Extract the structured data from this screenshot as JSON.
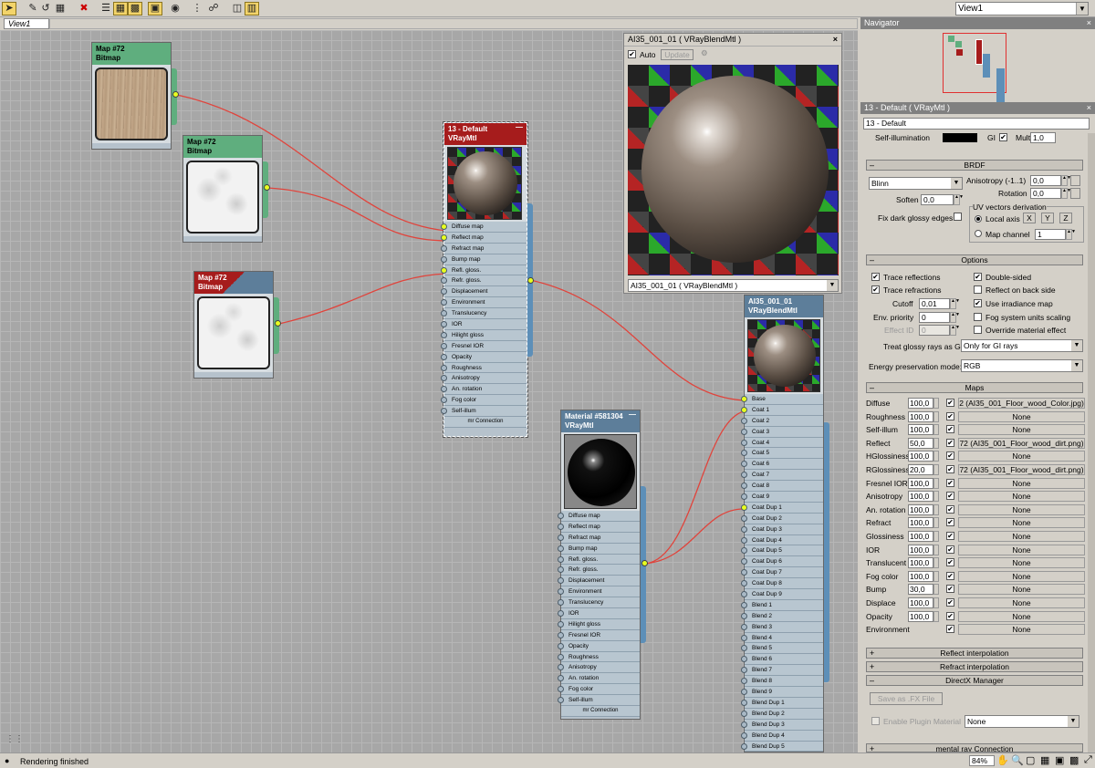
{
  "toolbar": {
    "icons": [
      "select-icon",
      "pick-icon",
      "put-material-icon",
      "assign-icon",
      "delete-icon",
      "layout-icon",
      "grid-icon",
      "pattern-icon",
      "show-map-icon",
      "hide-icon",
      "background-icon",
      "navigator-icon",
      "toggle-icon",
      "options-icon"
    ]
  },
  "view_selector": "View1",
  "tab": "View1",
  "nodes": {
    "map1": {
      "title": "Map #72",
      "subtitle": "Bitmap"
    },
    "map2": {
      "title": "Map #72",
      "subtitle": "Bitmap"
    },
    "map3": {
      "title": "Map #72",
      "subtitle": "Bitmap"
    },
    "default": {
      "title": "13 - Default",
      "subtitle": "VRayMtl",
      "slots": [
        "Diffuse map",
        "Reflect map",
        "Refract map",
        "Bump map",
        "Refl. gloss.",
        "Refr. gloss.",
        "Displacement",
        "Environment",
        "Translucency",
        "IOR",
        "Hilight gloss",
        "Fresnel IOR",
        "Opacity",
        "Roughness",
        "Anisotropy",
        "An. rotation",
        "Fog color",
        "Self-illum"
      ],
      "footer": "mr Connection"
    },
    "blend": {
      "title": "AI35_001_01",
      "subtitle": "VRayBlendMtl",
      "slots": [
        "Base",
        "Coat 1",
        "Coat 2",
        "Coat 3",
        "Coat 4",
        "Coat 5",
        "Coat 6",
        "Coat 7",
        "Coat 8",
        "Coat 9",
        "Coat Dup 1",
        "Coat Dup 2",
        "Coat Dup 3",
        "Coat Dup 4",
        "Coat Dup 5",
        "Coat Dup 6",
        "Coat Dup 7",
        "Coat Dup 8",
        "Coat Dup 9",
        "Blend 1",
        "Blend 2",
        "Blend 3",
        "Blend 4",
        "Blend 5",
        "Blend 6",
        "Blend 7",
        "Blend 8",
        "Blend 9",
        "Blend Dup 1",
        "Blend Dup 2",
        "Blend Dup 3",
        "Blend Dup 4",
        "Blend Dup 5"
      ]
    },
    "mat2": {
      "title": "Material #581304",
      "subtitle": "VRayMtl",
      "slots": [
        "Diffuse map",
        "Reflect map",
        "Refract map",
        "Bump map",
        "Refl. gloss.",
        "Refr. gloss.",
        "Displacement",
        "Environment",
        "Translucency",
        "IOR",
        "Hilight gloss",
        "Fresnel IOR",
        "Opacity",
        "Roughness",
        "Anisotropy",
        "An. rotation",
        "Fog color",
        "Self-illum"
      ],
      "footer": "mr Connection"
    }
  },
  "preview": {
    "title": "AI35_001_01  ( VRayBlendMtl )",
    "close": "×",
    "auto_label": "Auto",
    "update_label": "Update",
    "footer": "AI35_001_01  ( VRayBlendMtl )"
  },
  "navigator": {
    "title": "Navigator",
    "close": "×"
  },
  "material_panel": {
    "title": "13 - Default  ( VRayMtl )",
    "close": "×",
    "name": "13 - Default",
    "self_illum_label": "Self-illumination",
    "gi_label": "GI",
    "mult_label": "Mult",
    "mult_value": "1,0",
    "brdf": {
      "header": "BRDF",
      "type": "Blinn",
      "anisotropy_label": "Anisotropy (-1..1)",
      "anisotropy_value": "0,0",
      "rotation_label": "Rotation",
      "rotation_value": "0,0",
      "soften_label": "Soften",
      "soften_value": "0,0",
      "fix_label": "Fix dark glossy edges",
      "uv_label": "UV vectors derivation",
      "local_axis": "Local axis",
      "x": "X",
      "y": "Y",
      "z": "Z",
      "map_channel": "Map channel",
      "map_channel_value": "1"
    },
    "options": {
      "header": "Options",
      "trace_reflections": "Trace reflections",
      "trace_refractions": "Trace refractions",
      "cutoff_label": "Cutoff",
      "cutoff_value": "0,01",
      "env_priority_label": "Env. priority",
      "env_priority_value": "0",
      "effect_id_label": "Effect ID",
      "effect_id_value": "0",
      "double_sided": "Double-sided",
      "reflect_back": "Reflect on back side",
      "use_irradiance": "Use irradiance map",
      "fog_units": "Fog system units scaling",
      "override_effect": "Override material effect",
      "treat_glossy_label": "Treat glossy rays as GI",
      "treat_glossy_value": "Only for GI rays",
      "energy_label": "Energy preservation mode:",
      "energy_value": "RGB"
    },
    "maps": {
      "header": "Maps",
      "rows": [
        {
          "name": "Diffuse",
          "value": "100,0",
          "map": "2 (AI35_001_Floor_wood_Color.jpg)"
        },
        {
          "name": "Roughness",
          "value": "100,0",
          "map": "None"
        },
        {
          "name": "Self-illum",
          "value": "100,0",
          "map": "None"
        },
        {
          "name": "Reflect",
          "value": "50,0",
          "map": "72 (AI35_001_Floor_wood_dirt.png)"
        },
        {
          "name": "HGlossiness",
          "value": "100,0",
          "map": "None"
        },
        {
          "name": "RGlossiness",
          "value": "20,0",
          "map": "72 (AI35_001_Floor_wood_dirt.png)"
        },
        {
          "name": "Fresnel IOR",
          "value": "100,0",
          "map": "None"
        },
        {
          "name": "Anisotropy",
          "value": "100,0",
          "map": "None"
        },
        {
          "name": "An. rotation",
          "value": "100,0",
          "map": "None"
        },
        {
          "name": "Refract",
          "value": "100,0",
          "map": "None"
        },
        {
          "name": "Glossiness",
          "value": "100,0",
          "map": "None"
        },
        {
          "name": "IOR",
          "value": "100,0",
          "map": "None"
        },
        {
          "name": "Translucent",
          "value": "100,0",
          "map": "None"
        },
        {
          "name": "Fog color",
          "value": "100,0",
          "map": "None"
        },
        {
          "name": "Bump",
          "value": "30,0",
          "map": "None"
        },
        {
          "name": "Displace",
          "value": "100,0",
          "map": "None"
        },
        {
          "name": "Opacity",
          "value": "100,0",
          "map": "None"
        },
        {
          "name": "Environment",
          "value": "",
          "map": "None"
        }
      ]
    },
    "reflect_interp": "Reflect interpolation",
    "refract_interp": "Refract interpolation",
    "directx": {
      "header": "DirectX Manager",
      "save_fx": "Save as .FX File",
      "enable_plugin": "Enable Plugin Material",
      "plugin_value": "None"
    },
    "mental_ray": "mental ray Connection"
  },
  "status": {
    "message": "Rendering finished",
    "zoom": "84%"
  }
}
